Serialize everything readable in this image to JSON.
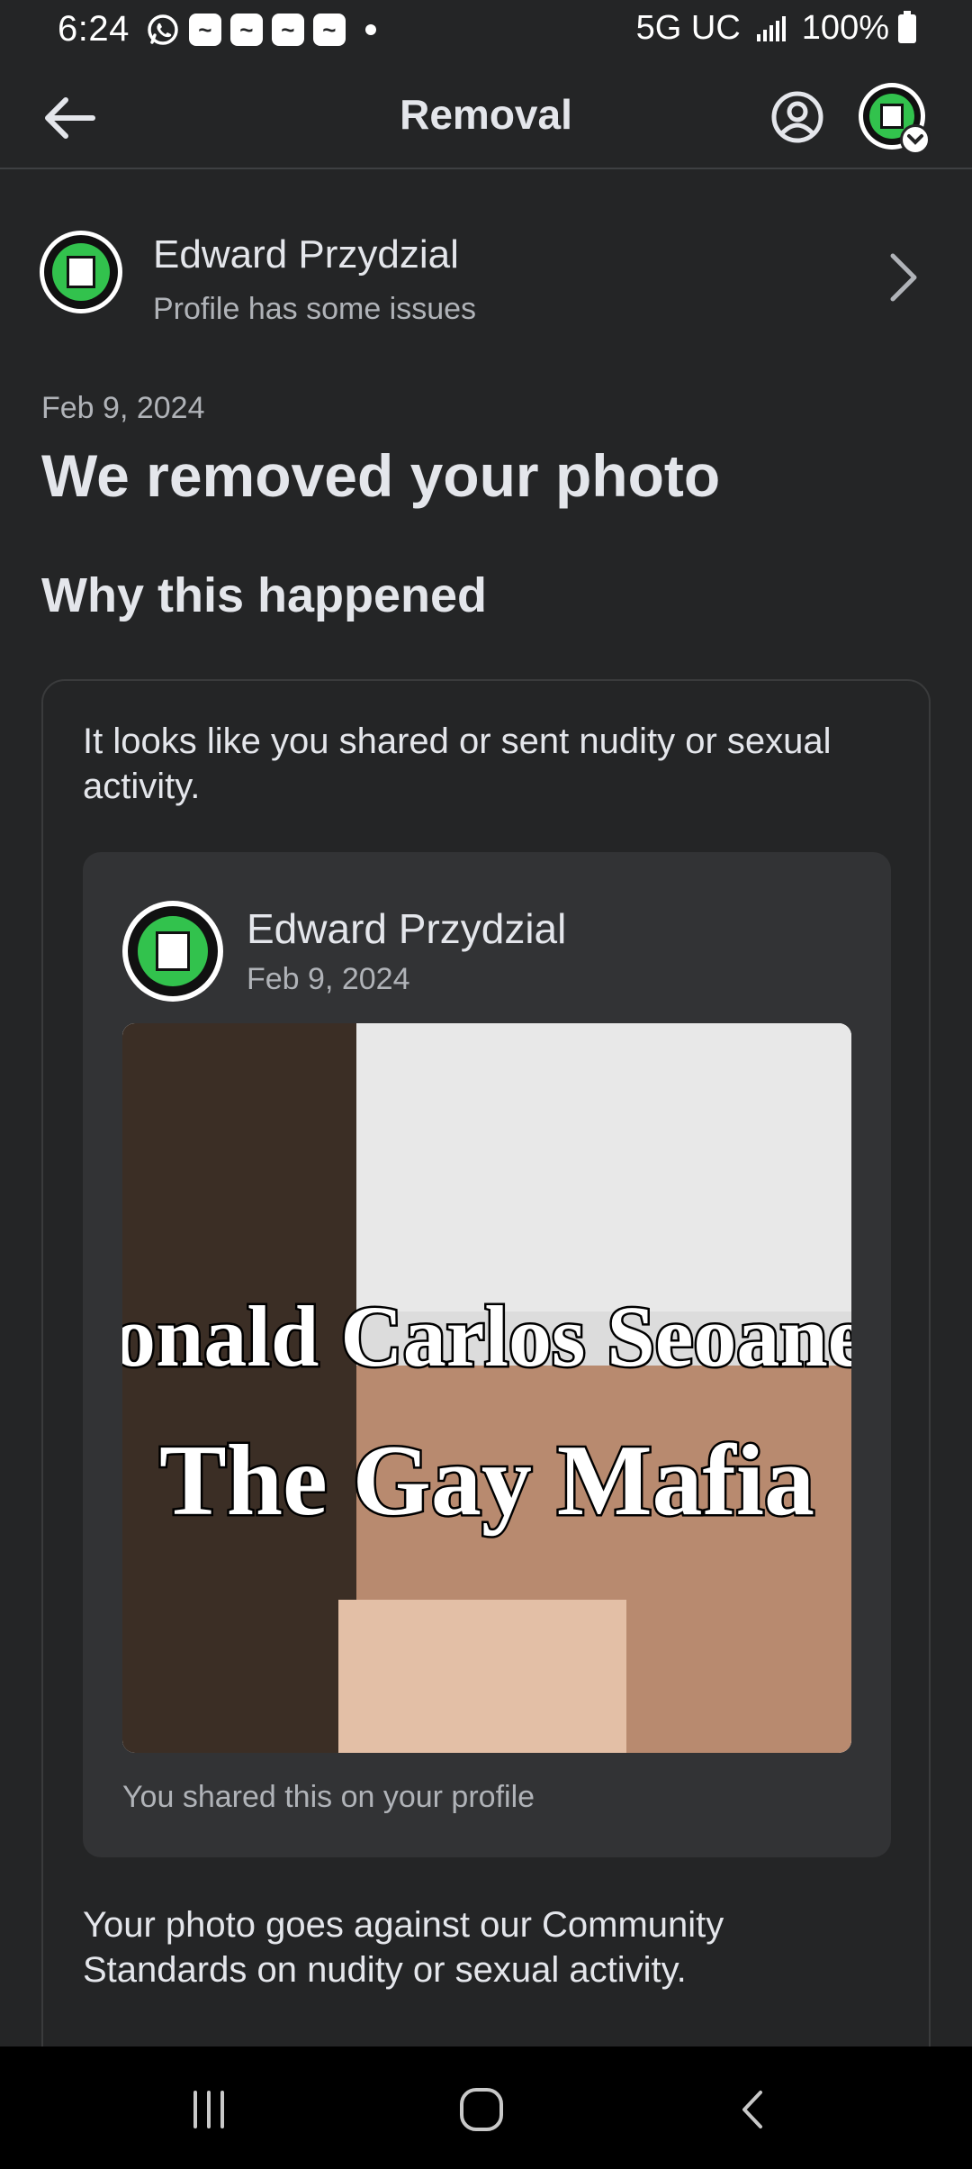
{
  "status_bar": {
    "time": "6:24",
    "network": "5G UC",
    "battery": "100%",
    "notification_icons": [
      "whatsapp-icon",
      "app-notification-icon",
      "app-notification-icon",
      "app-notification-icon",
      "app-notification-icon"
    ]
  },
  "header": {
    "title": "Removal",
    "back_icon": "arrow-left-icon",
    "profile_icon": "account-circle-icon"
  },
  "profile": {
    "name": "Edward Przydzial",
    "status": "Profile has some issues"
  },
  "notice": {
    "date": "Feb 9, 2024",
    "headline": "We removed your photo",
    "section_title": "Why this happened",
    "reason": "It looks like you shared or sent nudity or sexual activity.",
    "policy": "Your photo goes against our Community Standards on nudity or sexual activity."
  },
  "post": {
    "author": "Edward Przydzial",
    "date": "Feb 9, 2024",
    "image_text_line1": "Donald Carlos Seoane's",
    "image_text_line2": "The Gay Mafia",
    "caption": "You shared this on your profile"
  },
  "nav": {
    "recents_icon": "recents-icon",
    "home_icon": "home-icon",
    "back_icon": "nav-back-icon"
  },
  "colors": {
    "background": "#242526",
    "text_primary": "#e4e6eb",
    "text_secondary": "#b0b3b8",
    "card": "#323335",
    "logo_green": "#32c24d"
  }
}
